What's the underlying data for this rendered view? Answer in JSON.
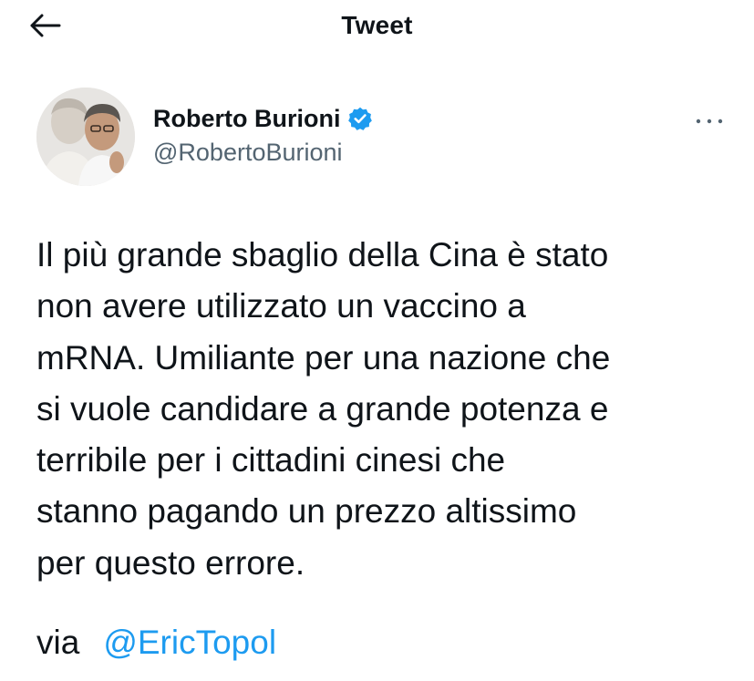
{
  "header": {
    "title": "Tweet",
    "back_icon": "arrow-left-icon"
  },
  "author": {
    "display_name": "Roberto Burioni",
    "handle": "@RobertoBurioni",
    "verified_icon": "verified-badge-icon",
    "verified_color": "#1d9bf0"
  },
  "more_icon": "more-horizontal-icon",
  "tweet": {
    "lines": [
      "Il più grande sbaglio della Cina è stato",
      "non avere utilizzato un vaccino a",
      "mRNA. Umiliante per una nazione che",
      "si vuole candidare a grande potenza e",
      "terribile per i cittadini cinesi che",
      "stanno pagando un prezzo altissimo",
      "per questo errore."
    ],
    "via_label": "via",
    "mention": "@EricTopol"
  },
  "colors": {
    "text": "#0f1419",
    "secondary": "#536471",
    "accent": "#1d9bf0"
  }
}
